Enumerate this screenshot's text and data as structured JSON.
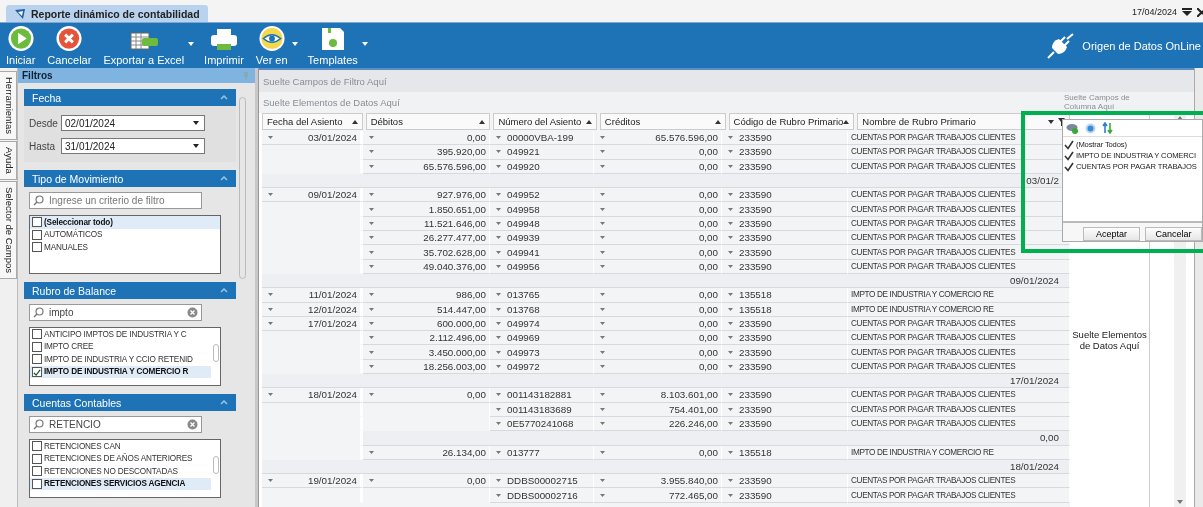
{
  "tab": {
    "title": "Reporte dinámico de contabilidad"
  },
  "date": "17/04/2024",
  "toolbar": [
    {
      "label": "Iniciar",
      "kind": "start",
      "dropdown": false
    },
    {
      "label": "Cancelar",
      "kind": "cancel",
      "dropdown": false
    },
    {
      "label": "Exportar a Excel",
      "kind": "excel",
      "dropdown": true
    },
    {
      "label": "Imprimir",
      "kind": "print",
      "dropdown": false
    },
    {
      "label": "Ver en",
      "kind": "view",
      "dropdown": true
    },
    {
      "label": "Templates",
      "kind": "templates",
      "dropdown": true
    }
  ],
  "data_source": "Origen de Datos OnLine",
  "side_tabs": [
    "Herramientas",
    "Ayuda",
    "Selector de Campos"
  ],
  "filters": {
    "title": "Filtros",
    "sections": [
      {
        "kind": "dates",
        "title": "Fecha",
        "fields": [
          {
            "label": "Desde",
            "value": "02/01/2024"
          },
          {
            "label": "Hasta",
            "value": "31/01/2024"
          }
        ]
      },
      {
        "kind": "list",
        "title": "Tipo de Movimiento",
        "search": {
          "placeholder": "Ingrese un criterio de filtro"
        },
        "items": [
          {
            "label": "(Seleccionar todo)",
            "checked": false,
            "selected": true
          },
          {
            "label": "AUTOMÁTICOS",
            "checked": false,
            "selected": false
          },
          {
            "label": "MANUALES",
            "checked": false,
            "selected": false
          }
        ]
      },
      {
        "kind": "list",
        "title": "Rubro de Balance",
        "search": {
          "value": "impto"
        },
        "items": [
          {
            "label": "ANTICIPO IMPTOS DE INDUSTRIA Y C",
            "checked": false,
            "selected": false
          },
          {
            "label": "IMPTO CREE",
            "checked": false,
            "selected": false
          },
          {
            "label": "IMPTO DE INDUSTRIA Y CCIO RETENID",
            "checked": false,
            "selected": false
          },
          {
            "label": "IMPTO DE INDUSTRIA Y COMERCIO R",
            "checked": true,
            "selected": true
          }
        ]
      },
      {
        "kind": "list",
        "title": "Cuentas Contables",
        "search": {
          "value": "RETENCIO"
        },
        "items": [
          {
            "label": "RETENCIONES CAN",
            "checked": false,
            "selected": false
          },
          {
            "label": "RETENCIONES DE AÑOS ANTERIORES",
            "checked": false,
            "selected": false
          },
          {
            "label": "RETENCIONES NO DESCONTADAS",
            "checked": false,
            "selected": false
          },
          {
            "label": "RETENCIONES SERVICIOS AGENCIA",
            "checked": false,
            "selected": true
          }
        ]
      }
    ]
  },
  "pivot": {
    "filter_area": "Suelte Campos de Filtro Aquí",
    "data_header_area": "Suelte Elementos de Datos Aquí",
    "column_area": "Suelte Campos de Columna Aquí",
    "columns": [
      {
        "label": "Fecha del Asiento",
        "sorted": true,
        "filtered": false
      },
      {
        "label": "Débitos",
        "sorted": true,
        "filtered": false
      },
      {
        "label": "Número del Asiento",
        "sorted": true,
        "filtered": false
      },
      {
        "label": "Créditos",
        "sorted": true,
        "filtered": false
      },
      {
        "label": "Código de Rubro Primario",
        "sorted": true,
        "filtered": false
      },
      {
        "label": "Nombre de Rubro Primario",
        "sorted": false,
        "filtered": true
      }
    ],
    "rows": [
      {
        "kind": "data",
        "date": "03/01/2024",
        "debit": "0,00",
        "number": "00000VBA-199",
        "credit": "65.576.596,00",
        "code": "233590",
        "name": "CUENTAS POR PAGAR TRABAJOS CLIENTES"
      },
      {
        "kind": "data",
        "debit": "395.920,00",
        "number": "049921",
        "credit": "0,00",
        "code": "233590",
        "name": "CUENTAS POR PAGAR TRABAJOS CLIENTES"
      },
      {
        "kind": "data",
        "debit": "65.576.596,00",
        "number": "049920",
        "credit": "0,00",
        "code": "233590",
        "name": "CUENTAS POR PAGAR TRABAJOS CLIENTES"
      },
      {
        "kind": "total",
        "value": "03/01/2"
      },
      {
        "kind": "data",
        "date": "09/01/2024",
        "debit": "927.976,00",
        "number": "049952",
        "credit": "0,00",
        "code": "233590",
        "name": "CUENTAS POR PAGAR TRABAJOS CLIENTES"
      },
      {
        "kind": "data",
        "debit": "1.850.651,00",
        "number": "049958",
        "credit": "0,00",
        "code": "233590",
        "name": "CUENTAS POR PAGAR TRABAJOS CLIENTES"
      },
      {
        "kind": "data",
        "debit": "11.521.646,00",
        "number": "049948",
        "credit": "0,00",
        "code": "233590",
        "name": "CUENTAS POR PAGAR TRABAJOS CLIENTES"
      },
      {
        "kind": "data",
        "debit": "26.277.477,00",
        "number": "049939",
        "credit": "0,00",
        "code": "233590",
        "name": "CUENTAS POR PAGAR TRABAJOS CLIENTES"
      },
      {
        "kind": "data",
        "debit": "35.702.628,00",
        "number": "049941",
        "credit": "0,00",
        "code": "233590",
        "name": "CUENTAS POR PAGAR TRABAJOS CLIENTES"
      },
      {
        "kind": "data",
        "debit": "49.040.376,00",
        "number": "049956",
        "credit": "0,00",
        "code": "233590",
        "name": "CUENTAS POR PAGAR TRABAJOS CLIENTES"
      },
      {
        "kind": "total",
        "value": "09/01/2024"
      },
      {
        "kind": "data",
        "date": "11/01/2024",
        "debit": "986,00",
        "number": "013765",
        "credit": "0,00",
        "code": "135518",
        "name": "IMPTO DE INDUSTRIA Y COMERCIO RE"
      },
      {
        "kind": "data",
        "date": "12/01/2024",
        "debit": "514.447,00",
        "number": "013768",
        "credit": "0,00",
        "code": "135518",
        "name": "IMPTO DE INDUSTRIA Y COMERCIO RE"
      },
      {
        "kind": "data",
        "date": "17/01/2024",
        "debit": "600.000,00",
        "number": "049974",
        "credit": "0,00",
        "code": "233590",
        "name": "CUENTAS POR PAGAR TRABAJOS CLIENTES"
      },
      {
        "kind": "data",
        "debit": "2.112.496,00",
        "number": "049969",
        "credit": "0,00",
        "code": "233590",
        "name": "CUENTAS POR PAGAR TRABAJOS CLIENTES"
      },
      {
        "kind": "data",
        "debit": "3.450.000,00",
        "number": "049973",
        "credit": "0,00",
        "code": "233590",
        "name": "CUENTAS POR PAGAR TRABAJOS CLIENTES"
      },
      {
        "kind": "data",
        "debit": "18.256.003,00",
        "number": "049972",
        "credit": "0,00",
        "code": "233590",
        "name": "CUENTAS POR PAGAR TRABAJOS CLIENTES"
      },
      {
        "kind": "total",
        "value": "17/01/2024"
      },
      {
        "kind": "data",
        "date": "18/01/2024",
        "debit": "0,00",
        "number": "001143182881",
        "credit": "8.103.601,00",
        "code": "233590",
        "name": "CUENTAS POR PAGAR TRABAJOS CLIENTES"
      },
      {
        "kind": "data",
        "number": "001143183689",
        "credit": "754.401,00",
        "code": "233590",
        "name": "CUENTAS POR PAGAR TRABAJOS CLIENTES"
      },
      {
        "kind": "data",
        "number": "0E5770241068",
        "credit": "226.246,00",
        "code": "233590",
        "name": "CUENTAS POR PAGAR TRABAJOS CLIENTES"
      },
      {
        "kind": "subtotal",
        "value": "0,00"
      },
      {
        "kind": "data",
        "debit": "26.134,00",
        "number": "013777",
        "credit": "0,00",
        "code": "135518",
        "name": "IMPTO DE INDUSTRIA Y COMERCIO RE"
      },
      {
        "kind": "total",
        "value": "18/01/2024"
      },
      {
        "kind": "data",
        "date": "19/01/2024",
        "debit": "0,00",
        "number": "DDBS00002715",
        "credit": "3.955.840,00",
        "code": "233590",
        "name": "CUENTAS POR PAGAR TRABAJOS CLIENTES"
      },
      {
        "kind": "data",
        "number": "DDBS00002716",
        "credit": "772.465,00",
        "code": "233590",
        "name": "CUENTAS POR PAGAR TRABAJOS CLIENTES"
      }
    ],
    "data_area": "Suelte Elementos de Datos Aquí"
  },
  "filter_popup": {
    "items": [
      {
        "label": "(Mostrar Todos)",
        "checked": true
      },
      {
        "label": "IMPTO DE INDUSTRIA Y COMERCI",
        "checked": true
      },
      {
        "label": "CUENTAS POR PAGAR TRABAJOS",
        "checked": true
      }
    ],
    "buttons": [
      "Aceptar",
      "Cancelar"
    ]
  },
  "highlight": {
    "shown": true
  }
}
